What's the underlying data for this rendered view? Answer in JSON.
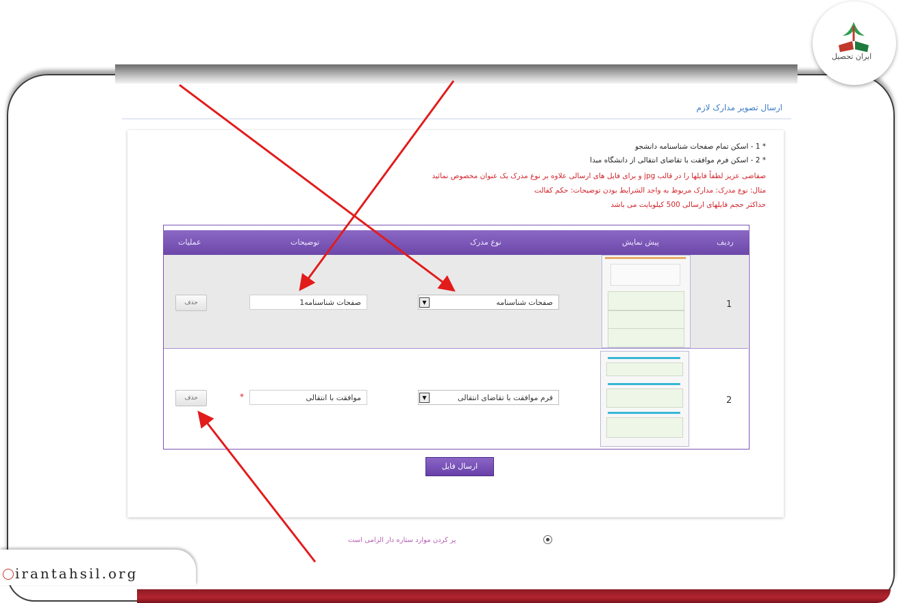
{
  "page": {
    "section_title": "ارسال تصویر مدارک لازم",
    "instructions": [
      {
        "text": "* 1 - اسکن تمام صفحات شناسنامه دانشجو",
        "color": "black"
      },
      {
        "text": "* 2 - اسکن فرم موافقت با تقاضای انتقالی از دانشگاه مبدا",
        "color": "black"
      },
      {
        "text": "صفاضی عزیز لطفاً فایلها را در قالب jpg و برای فایل های ارسالی علاوه بر نوع مدرک یک عنوان مخصوص نمائید",
        "color": "red"
      },
      {
        "text": "مثال: نوع مدرک: مدارک مربوط به واجد الشرایط بودن   توضیحات: حکم کفالت",
        "color": "red"
      },
      {
        "text": "حداکثر حجم فایلهای ارسالی 500 کیلوبایت می باشد",
        "color": "red"
      }
    ]
  },
  "table": {
    "headers": {
      "row": "ردیف",
      "preview": "پیش نمایش",
      "doc_type": "نوع مدرک",
      "description": "توضیحات",
      "operations": "عملیات"
    },
    "rows": [
      {
        "number": "1",
        "doc_type": "صفحات شناسنامه",
        "description": "صفحات شناسنامه1",
        "delete_label": "حذف"
      },
      {
        "number": "2",
        "doc_type": "فرم موافقت با تقاضای انتقالی",
        "description": "موافقت با انتقالی",
        "delete_label": "حذف",
        "required_mark": "*"
      }
    ]
  },
  "send_button": "ارسال فایل",
  "footnote": "پر کردن موارد ستاره دار الزامی است",
  "branding": {
    "logo_text": "ایران تحصیل",
    "site": "irantahsil.org"
  },
  "colors": {
    "header_purple": "#7a55b8",
    "instruction_red": "#d2232a",
    "arrow_red": "#e21b1b",
    "frame_red": "#b2232e"
  }
}
